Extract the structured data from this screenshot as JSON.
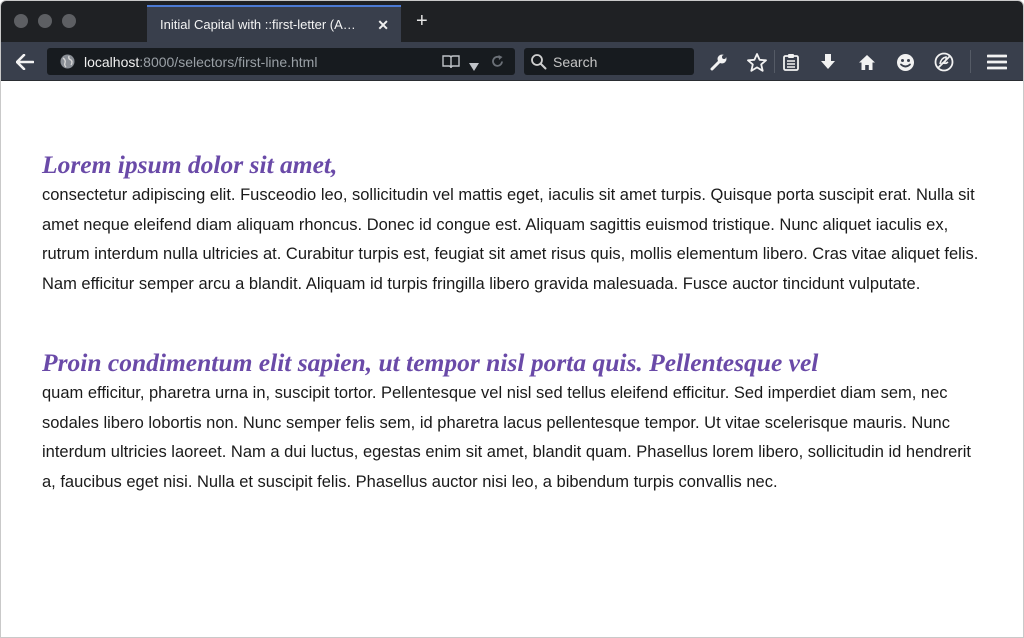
{
  "browser": {
    "tab": {
      "title": "Initial Capital with ::first-letter (A…",
      "close_label": "✕"
    },
    "new_tab_label": "+",
    "url": {
      "host": "localhost",
      "path": ":8000/selectors/first-line.html"
    },
    "search": {
      "placeholder": "Search"
    },
    "accent_color": "#4c7ad4",
    "toolbar_icons": [
      "back-icon",
      "globe-icon",
      "reader-view-icon",
      "dropdown-icon",
      "reload-icon",
      "search-icon",
      "wrench-icon",
      "star-icon",
      "clipboard-icon",
      "download-icon",
      "home-icon",
      "smiley-icon",
      "no-tracking-icon",
      "menu-icon"
    ]
  },
  "page": {
    "heading_color": "#6a4aa8",
    "paragraphs": [
      {
        "first_line": "Lorem ipsum dolor sit amet,",
        "rest": "consectetur adipiscing elit. Fusceodio leo, sollicitudin vel mattis eget, iaculis sit amet turpis. Quisque porta suscipit erat. Nulla sit amet neque eleifend diam aliquam rhoncus. Donec id congue est. Aliquam sagittis euismod tristique. Nunc aliquet iaculis ex, rutrum interdum nulla ultricies at. Curabitur turpis est, feugiat sit amet risus quis, mollis elementum libero. Cras vitae aliquet felis. Nam efficitur semper arcu a blandit. Aliquam id turpis fringilla libero gravida malesuada. Fusce auctor tincidunt vulputate."
      },
      {
        "first_line": "Proin condimentum elit sapien, ut tempor nisl porta quis. Pellentesque vel",
        "rest": "quam efficitur, pharetra urna in, suscipit tortor. Pellentesque vel nisl sed tellus eleifend efficitur. Sed imperdiet diam sem, nec sodales libero lobortis non. Nunc semper felis sem, id pharetra lacus pellentesque tempor. Ut vitae scelerisque mauris. Nunc interdum ultricies laoreet. Nam a dui luctus, egestas enim sit amet, blandit quam. Phasellus lorem libero, sollicitudin id hendrerit a, faucibus eget nisi. Nulla et suscipit felis. Phasellus auctor nisi leo, a bibendum turpis convallis nec."
      }
    ]
  }
}
